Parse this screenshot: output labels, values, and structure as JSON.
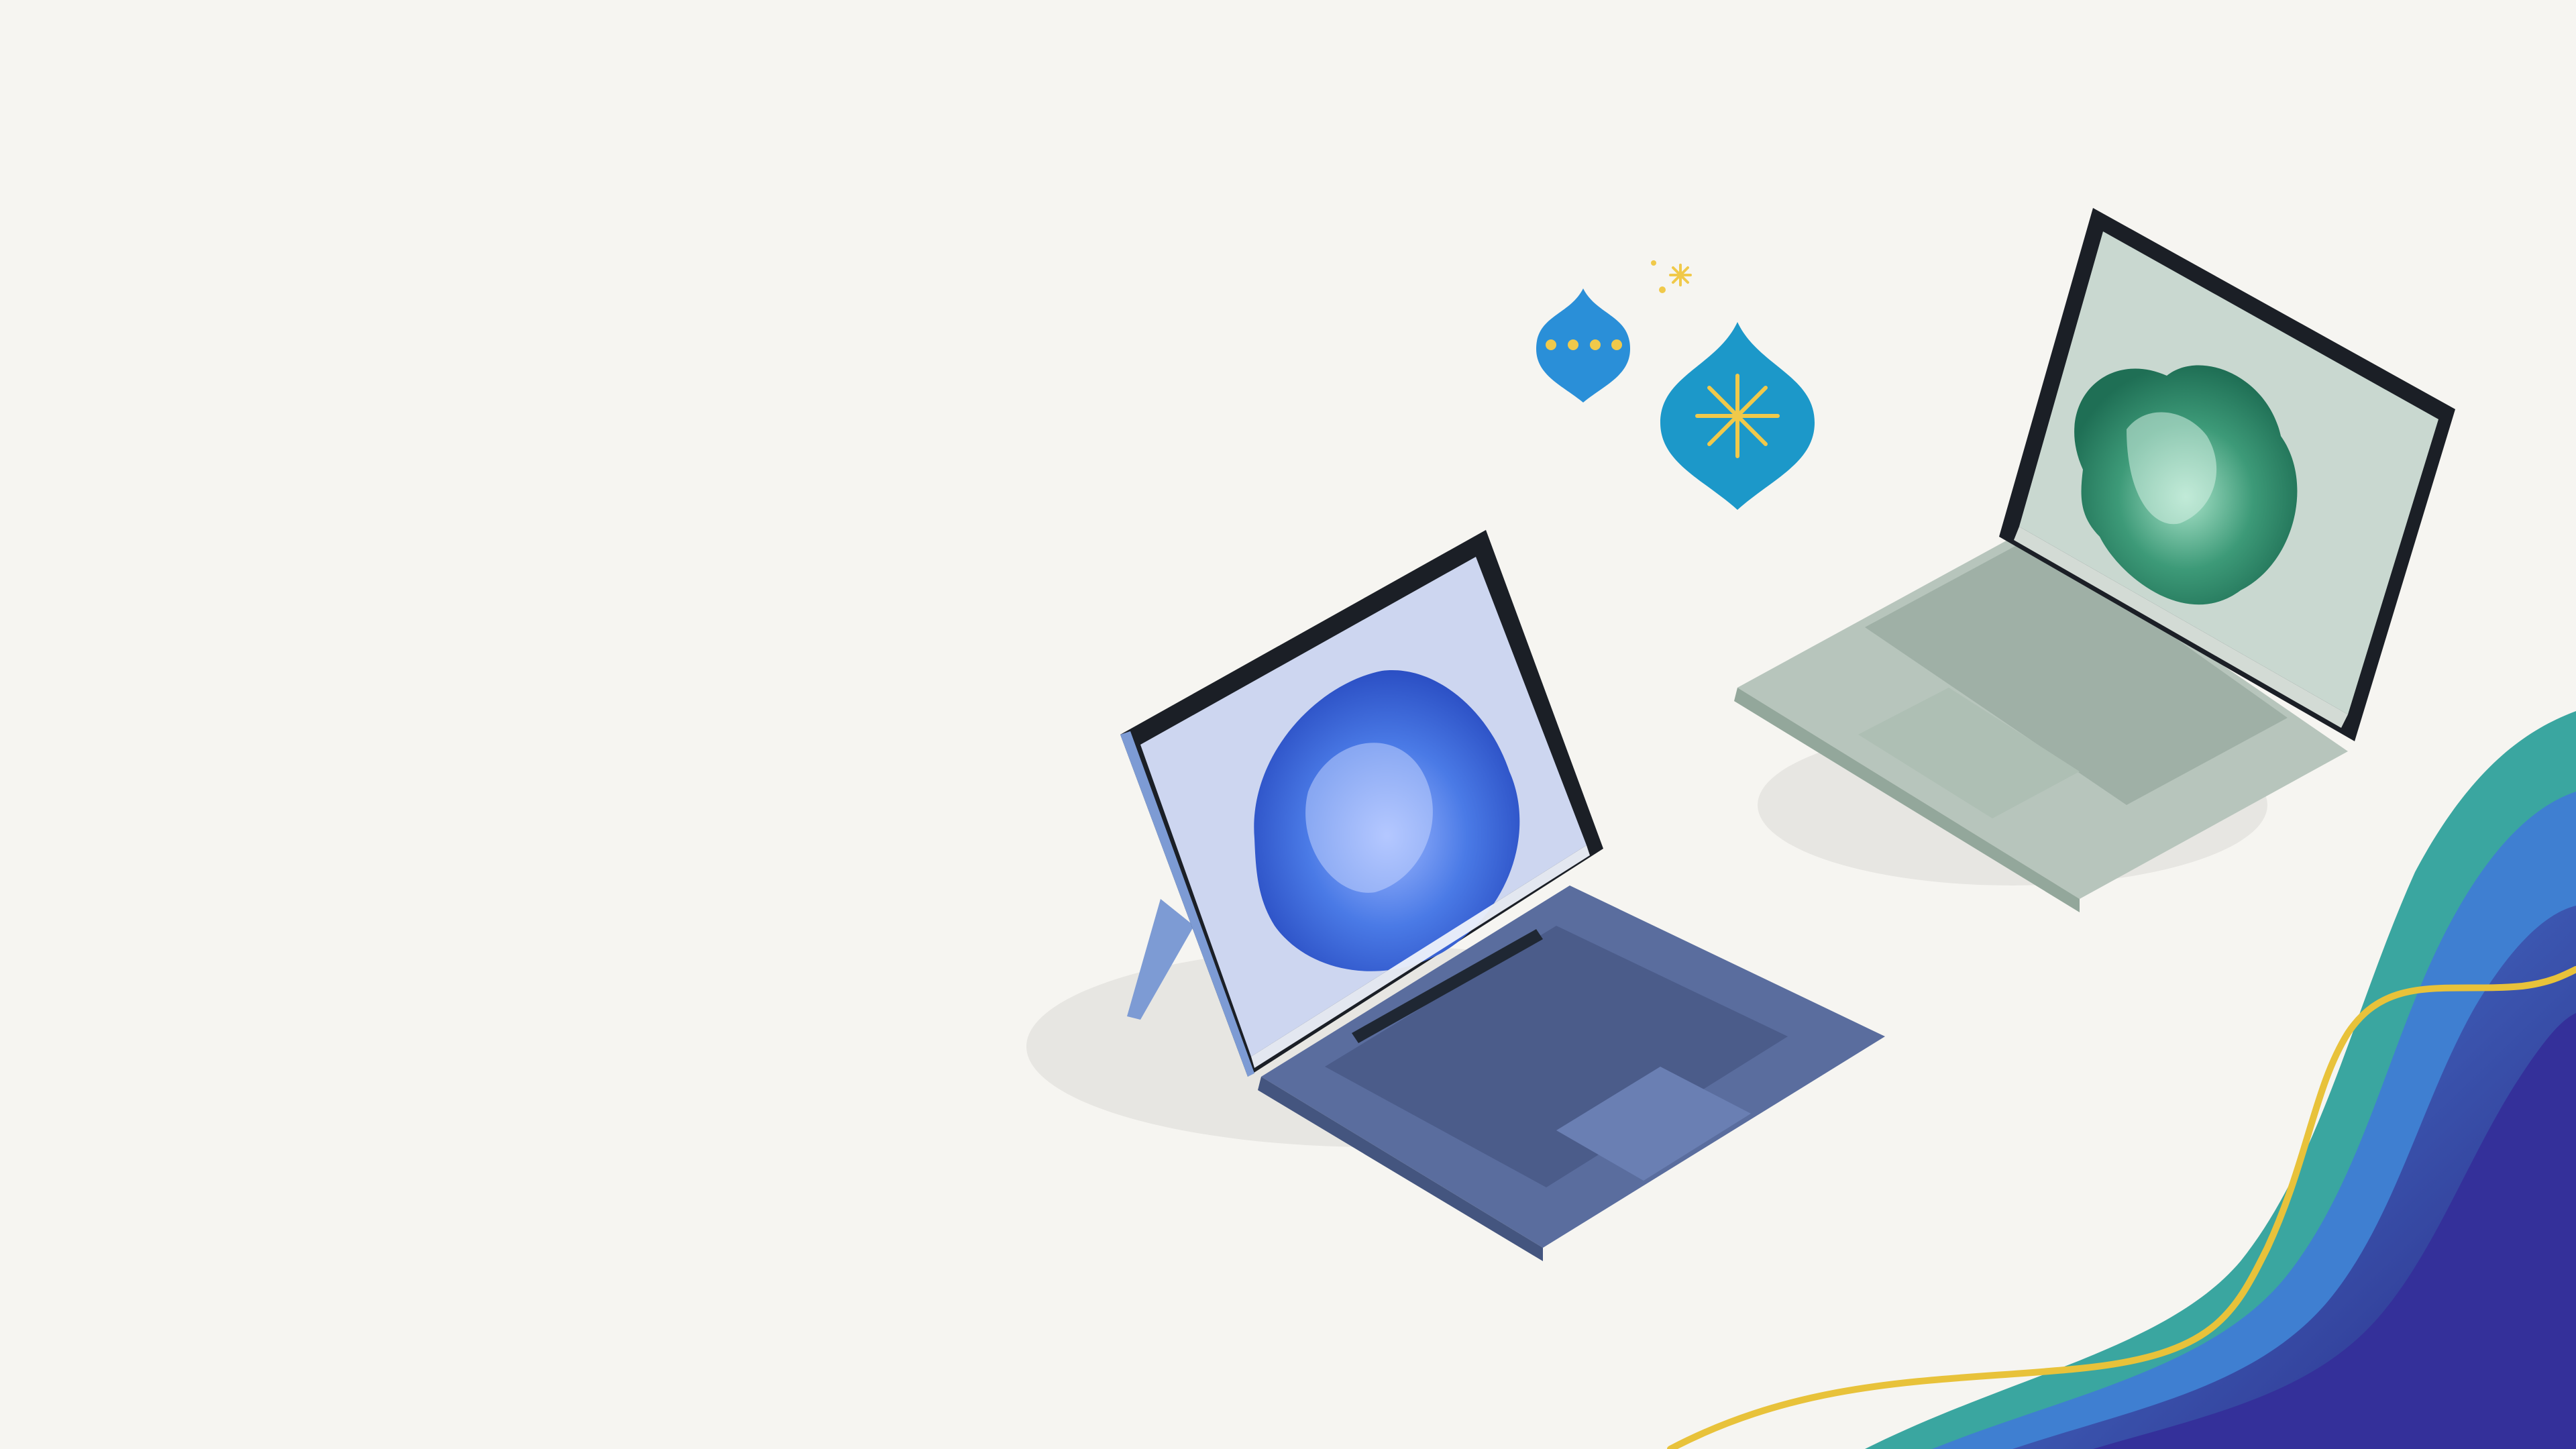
{
  "scene": {
    "background_color": "#f6f5f1",
    "devices": [
      {
        "name": "surface-pro",
        "body_color": "#7d9bd4",
        "keyboard_color": "#5a6d9e",
        "screen_bg": "#cdd6f0",
        "bloom_color": "#3f73e0"
      },
      {
        "name": "surface-laptop",
        "body_color": "#b7c5bc",
        "keyboard_color": "#9fb0a6",
        "screen_bg": "#c9d8d0",
        "bloom_color": "#3d9a78"
      }
    ],
    "ornaments": [
      {
        "name": "small-ornament",
        "color": "#2a8fd8",
        "decoration": "dots",
        "decoration_color": "#f0c94a"
      },
      {
        "name": "large-ornament",
        "color": "#1c98c9",
        "decoration": "starburst",
        "decoration_color": "#f0c94a"
      }
    ],
    "waves": {
      "colors": [
        "#3aa6a0",
        "#3f7fd1",
        "#5b6fd6",
        "#34309a"
      ],
      "ribbon_color": "#e8c23a"
    }
  }
}
